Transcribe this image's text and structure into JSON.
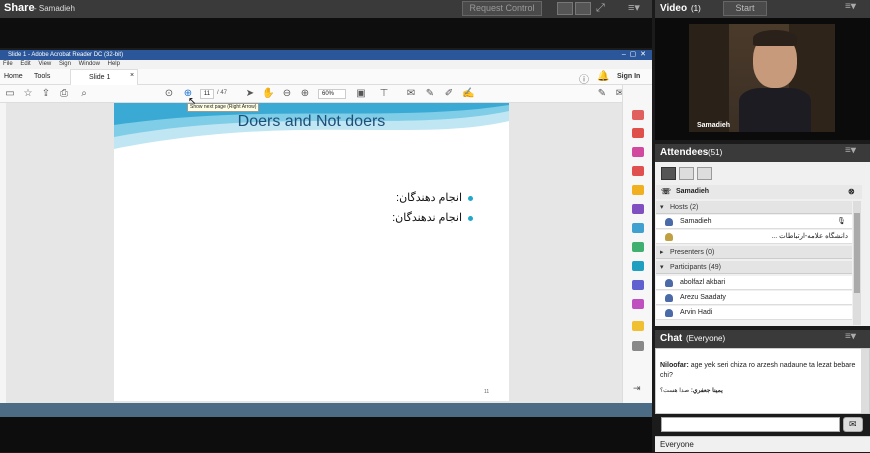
{
  "share": {
    "title": "Share",
    "presenter": "- Samadieh",
    "request_control": "Request Control"
  },
  "acrobat": {
    "window_title": "Slide 1 - Adobe Acrobat Reader DC (32-bit)",
    "menu": [
      "File",
      "Edit",
      "View",
      "Sign",
      "Window",
      "Help"
    ],
    "tabs": {
      "home": "Home",
      "tools": "Tools",
      "doc": "Slide 1",
      "close": "×"
    },
    "sign_in": "Sign In",
    "page_current": "11",
    "page_total": "/ 47",
    "zoom": "60%",
    "tooltip": "Show next page (Right Arrow)"
  },
  "slide": {
    "title": "Doers and Not doers",
    "bullets": [
      "انجام دهندگان:",
      "انجام ندهندگان:"
    ],
    "number": "11"
  },
  "video": {
    "title": "Video",
    "count": "(1)",
    "start": "Start",
    "user": "Samadieh"
  },
  "attendees": {
    "title": "Attendees",
    "count": "(51)",
    "me": "Samadieh",
    "hosts_label": "Hosts (2)",
    "hosts": [
      "Samadieh",
      "دانشگاه علامه-ارتباطات ..."
    ],
    "presenters_label": "Presenters (0)",
    "participants_label": "Participants (49)",
    "participants": [
      "abolfazl akbari",
      "Arezu Saadaty",
      "Arvin Hadi"
    ]
  },
  "chat": {
    "title": "Chat",
    "scope": "(Everyone)",
    "messages": [
      {
        "sender": "Niloofar:",
        "text": "age yek seri chiza ro arzesh nadaune ta lezat bebare chi?"
      },
      {
        "sender": "يمينا جعفري:",
        "text": "صدا هست؟"
      }
    ],
    "footer": "Everyone"
  }
}
